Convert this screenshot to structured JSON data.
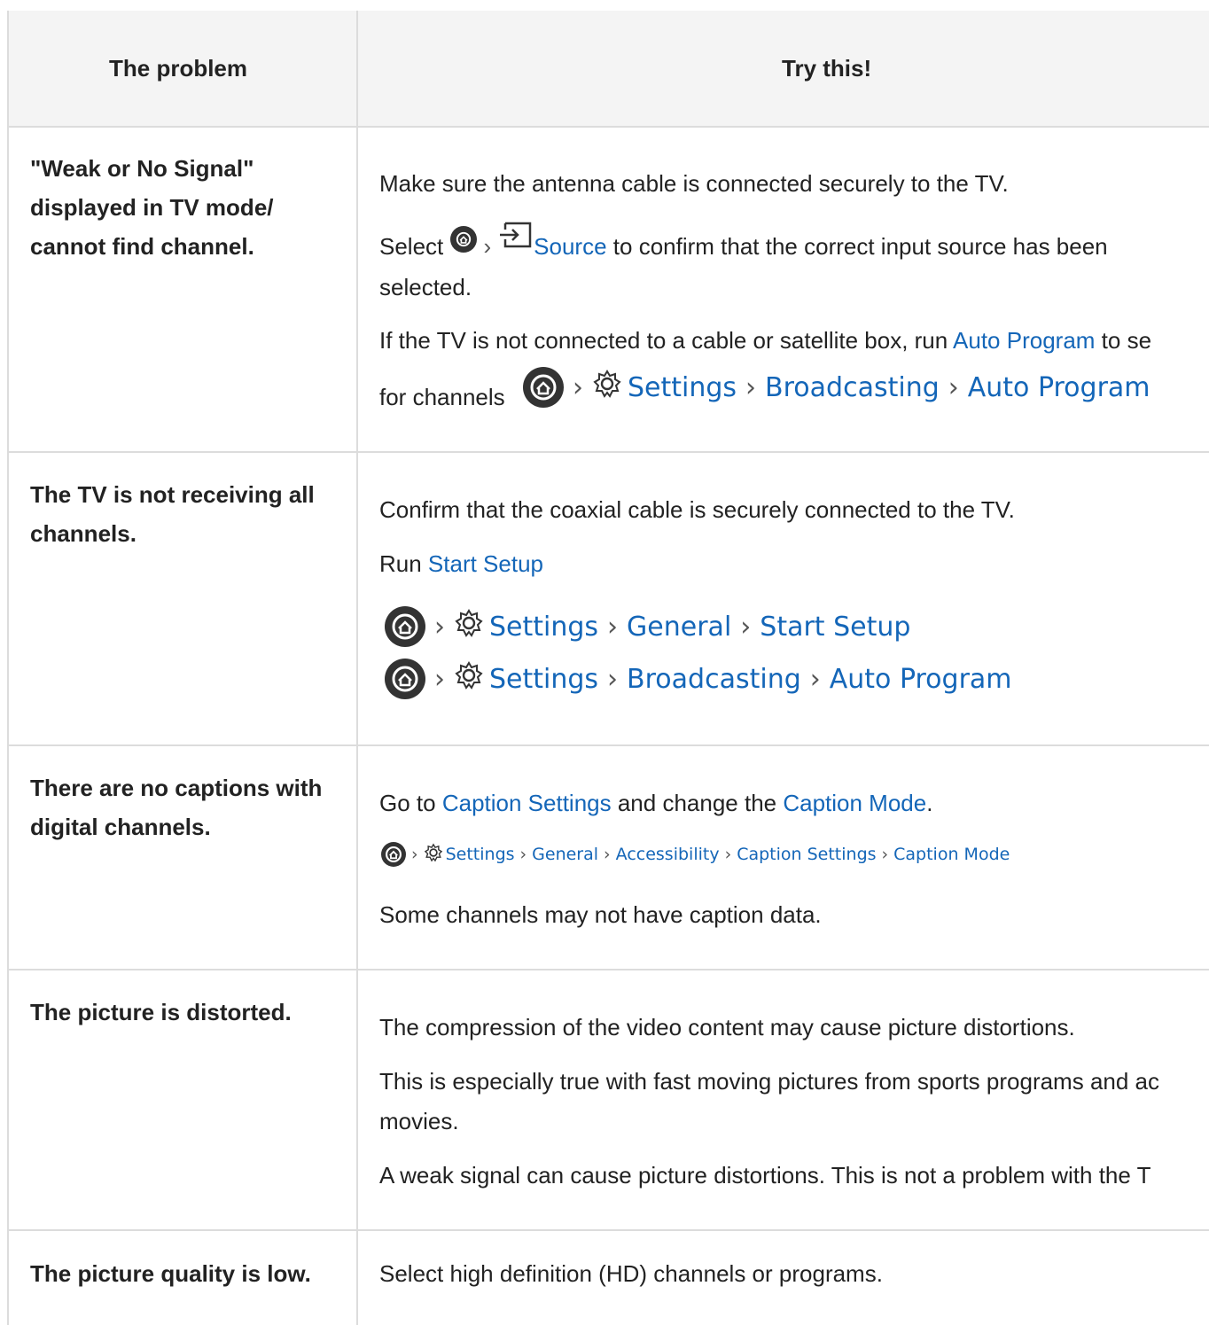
{
  "table": {
    "header": {
      "problem": "The problem",
      "try": "Try this!"
    },
    "rows": [
      {
        "problem": "\"Weak or No Signal\" displayed in TV mode/ cannot find channel.",
        "p1": "Make sure the antenna cable is connected securely to the TV.",
        "p2_pre": "Select ",
        "p2_link": "Source",
        "p2_post": " to confirm that the correct input source has been",
        "p2_line2": "selected.",
        "p3_pre": "If the TV is not connected to a cable or satellite box, run ",
        "p3_link": "Auto Program",
        "p3_post": " to se",
        "p4_pre": "for channels ",
        "path": [
          "Settings",
          "Broadcasting",
          "Auto Program"
        ]
      },
      {
        "problem": "The TV is not receiving all channels.",
        "p1": "Confirm that the coaxial cable is securely connected to the TV.",
        "p2_pre": "Run ",
        "p2_link": "Start Setup",
        "path1": [
          "Settings",
          "General",
          "Start Setup"
        ],
        "path2": [
          "Settings",
          "Broadcasting",
          "Auto Program"
        ]
      },
      {
        "problem": "There are no captions with digital channels.",
        "p1_pre": "Go to ",
        "p1_link1": "Caption Settings",
        "p1_mid": " and change the ",
        "p1_link2": "Caption Mode",
        "p1_post": ".",
        "path": [
          "Settings",
          "General",
          "Accessibility",
          "Caption Settings",
          "Caption Mode"
        ],
        "p2": "Some channels may not have caption data."
      },
      {
        "problem": "The picture is distorted.",
        "p1": "The compression of the video content may cause picture distortions.",
        "p2": "This is especially true with fast moving pictures from sports programs and ac",
        "p2_line2": "movies.",
        "p3": "A weak signal can cause picture distortions. This is not a problem with the T"
      },
      {
        "problem": "The picture quality is low.",
        "p1": "Select high definition (HD) channels or programs."
      }
    ]
  },
  "colors": {
    "link": "#1466b8",
    "header_bg": "#f4f4f4",
    "border": "#dcdcdc"
  },
  "icons": [
    "home-icon",
    "source-input-icon",
    "gear-icon",
    "chevron-right-icon"
  ]
}
